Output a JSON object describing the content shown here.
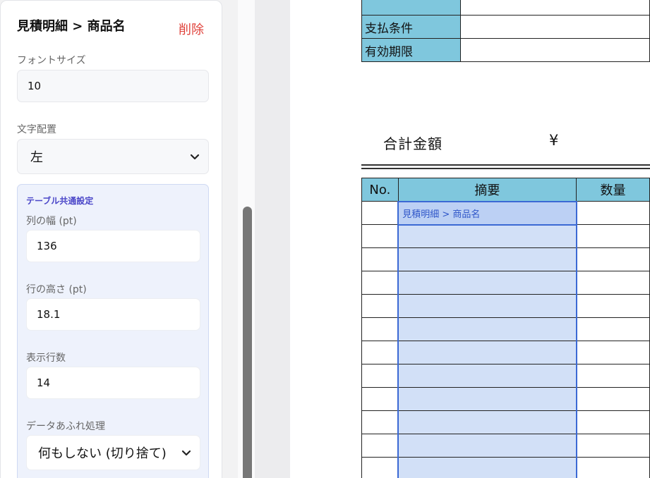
{
  "panel": {
    "title": "見積明細 > 商品名",
    "delete_label": "削除",
    "font_size": {
      "label": "フォントサイズ",
      "value": "10"
    },
    "align": {
      "label": "文字配置",
      "value": "左"
    },
    "table_settings": {
      "title": "テーブル共通設定",
      "col_width": {
        "label": "列の幅 (pt)",
        "value": "136"
      },
      "row_height": {
        "label": "行の高さ (pt)",
        "value": "18.1"
      },
      "rows": {
        "label": "表示行数",
        "value": "14"
      },
      "overflow": {
        "label": "データあふれ処理",
        "value": "何もしない (切り捨て)"
      }
    }
  },
  "document": {
    "info_rows": [
      {
        "label": ""
      },
      {
        "label": "支払条件"
      },
      {
        "label": "有効期限"
      }
    ],
    "total_label": "合計金額",
    "currency": "¥",
    "table": {
      "headers": [
        "No.",
        "摘要",
        "数量"
      ],
      "selected_field": "見積明細 > 商品名"
    }
  }
}
